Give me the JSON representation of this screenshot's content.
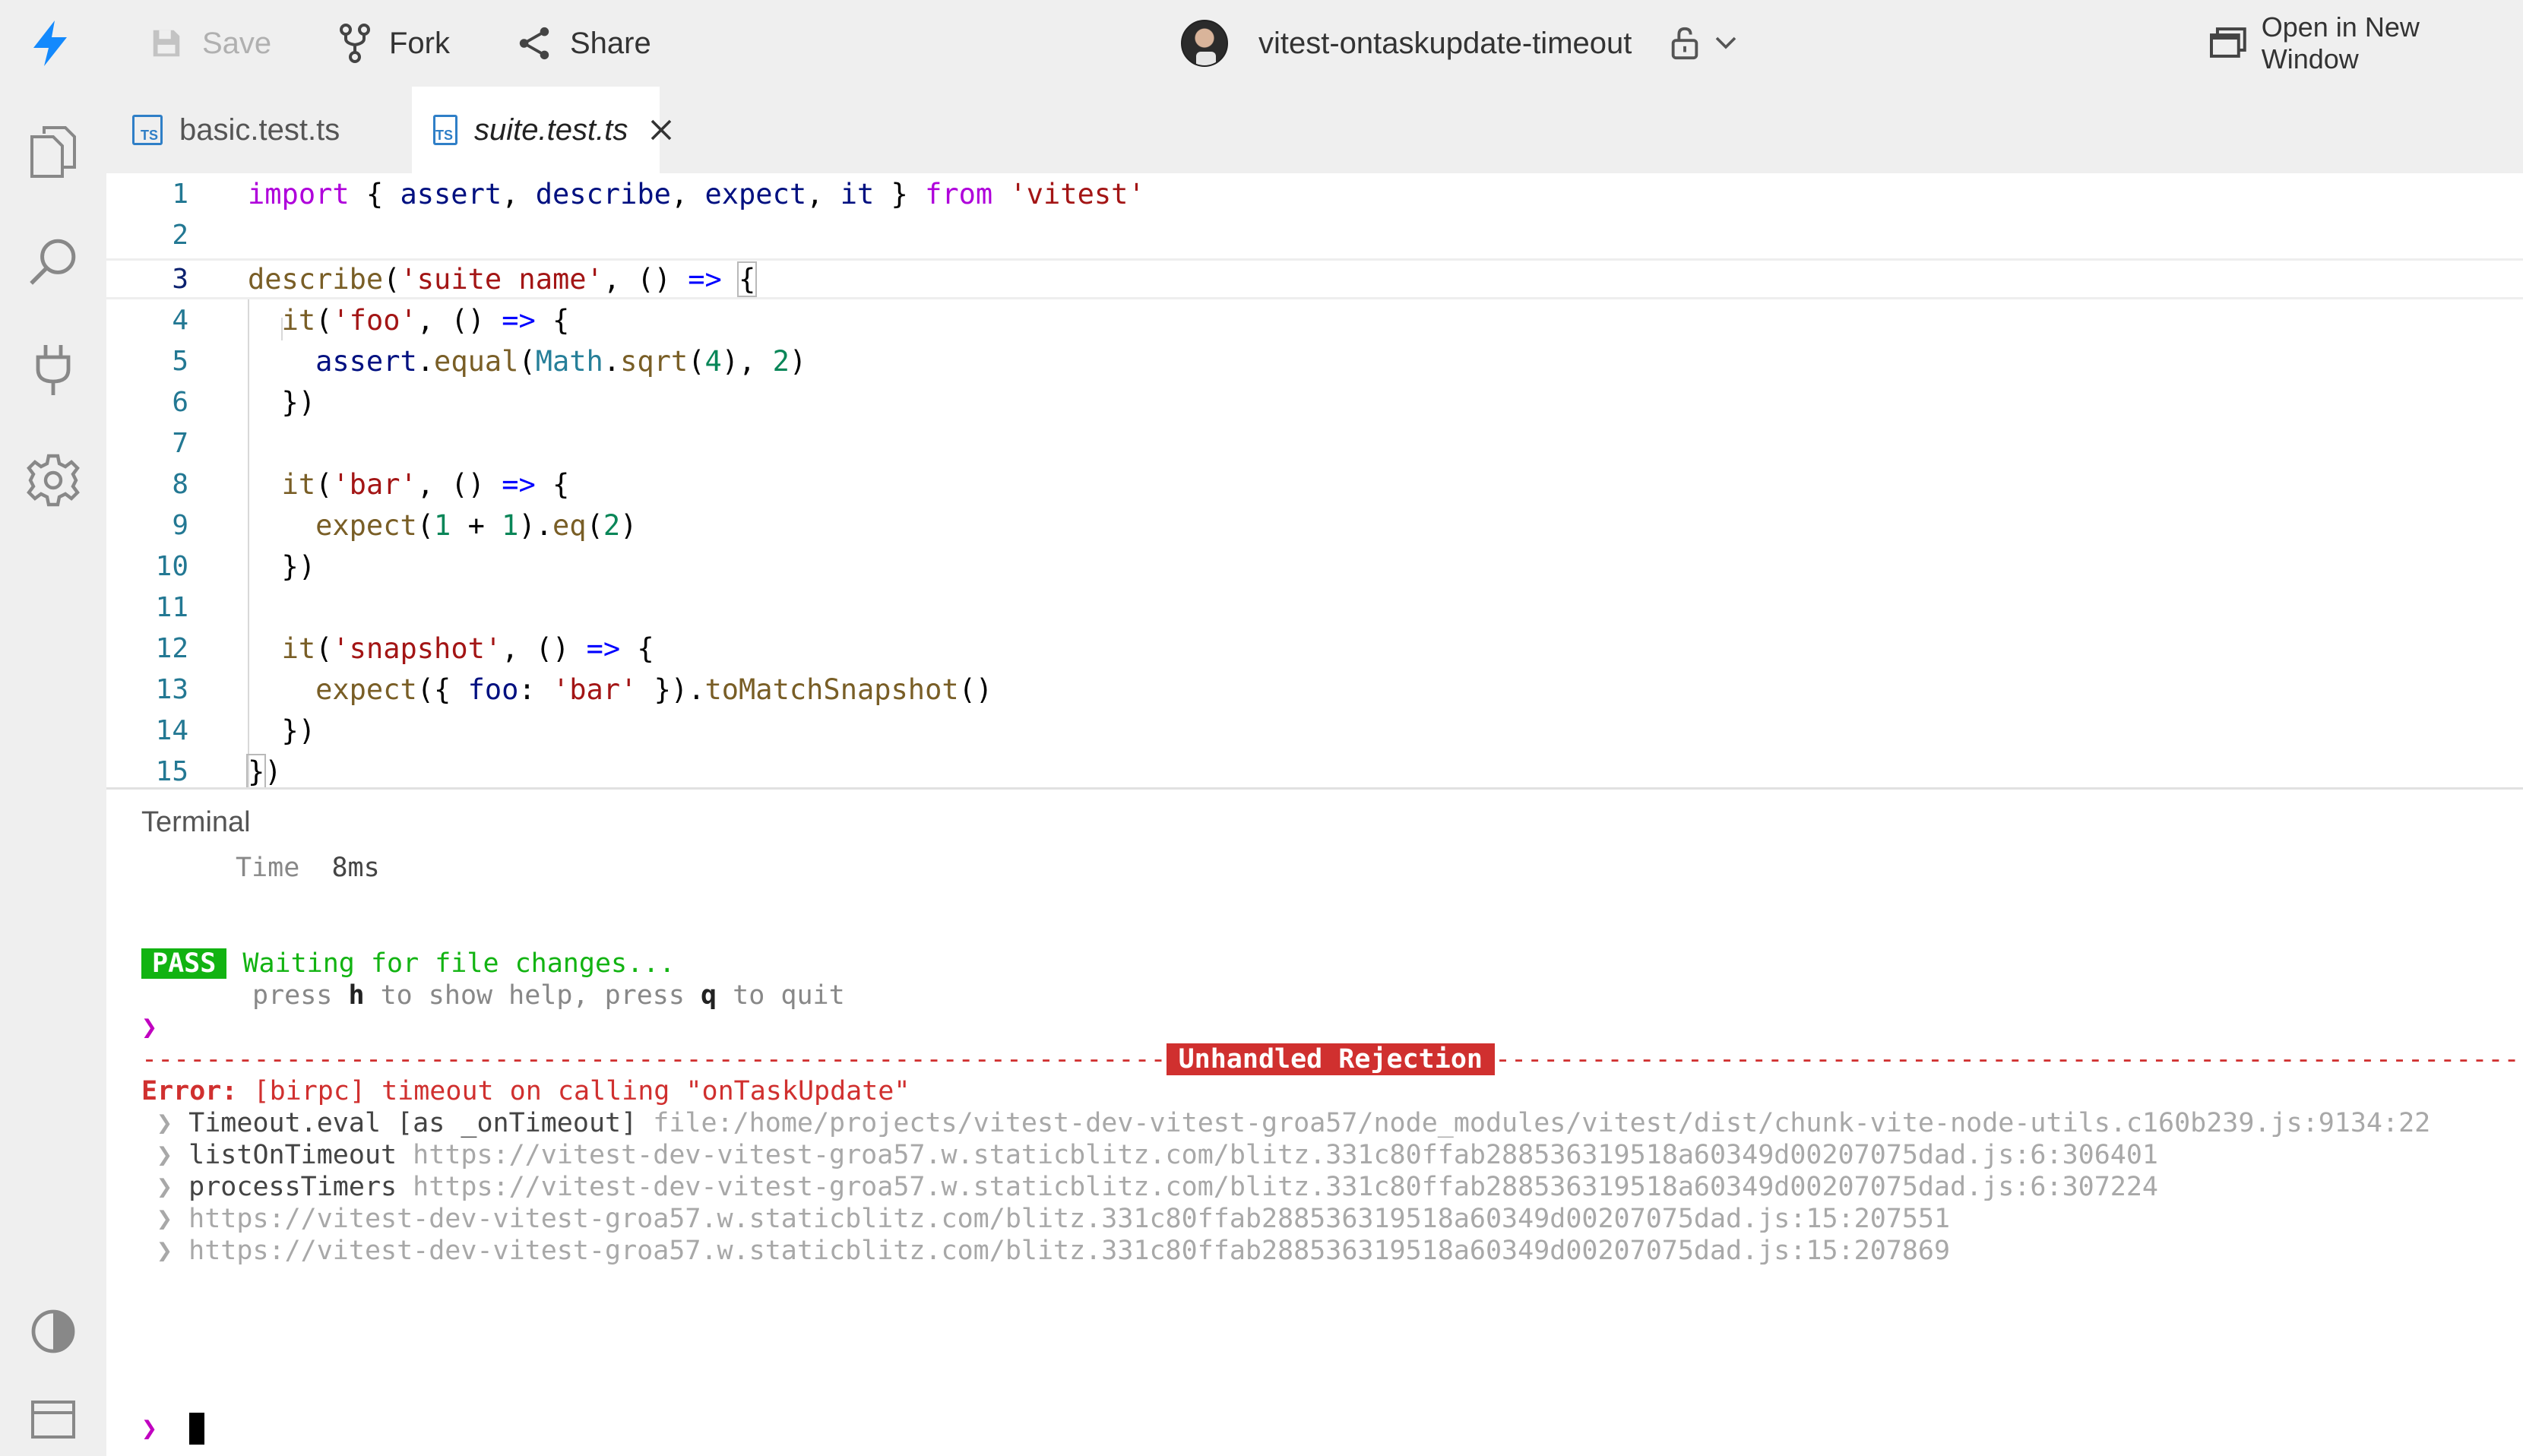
{
  "toolbar": {
    "save_label": "Save",
    "fork_label": "Fork",
    "share_label": "Share",
    "project_name": "vitest-ontaskupdate-timeout",
    "open_window_label": "Open in New Window",
    "icons": [
      "bolt-icon",
      "save-icon",
      "fork-icon",
      "share-icon",
      "lock-icon",
      "chevron-down-icon",
      "window-icon"
    ],
    "accent_color": "#1389fd"
  },
  "sidebar": {
    "icons": [
      "files-icon",
      "search-icon",
      "plug-icon",
      "gear-icon",
      "contrast-icon",
      "panel-icon"
    ]
  },
  "tabs": [
    {
      "label": "basic.test.ts",
      "badge": "TS",
      "active": false
    },
    {
      "label": "suite.test.ts",
      "badge": "TS",
      "active": true
    }
  ],
  "editor": {
    "current_line": 3,
    "lines": [
      {
        "n": "1"
      },
      {
        "n": "2"
      },
      {
        "n": "3"
      },
      {
        "n": "4"
      },
      {
        "n": "5"
      },
      {
        "n": "6"
      },
      {
        "n": "7"
      },
      {
        "n": "8"
      },
      {
        "n": "9"
      },
      {
        "n": "10"
      },
      {
        "n": "11"
      },
      {
        "n": "12"
      },
      {
        "n": "13"
      },
      {
        "n": "14"
      },
      {
        "n": "15"
      }
    ],
    "tokens": {
      "l1": [
        "import",
        " { ",
        "assert",
        ", ",
        "describe",
        ", ",
        "expect",
        ", ",
        "it",
        " } ",
        "from",
        " ",
        "'vitest'"
      ],
      "l3": [
        "describe",
        "(",
        "'suite name'",
        ", () ",
        "=>",
        " ",
        "{"
      ],
      "l4": [
        "  ",
        "it",
        "(",
        "'foo'",
        ", () ",
        "=>",
        " {"
      ],
      "l5": [
        "    ",
        "assert",
        ".",
        "equal",
        "(",
        "Math",
        ".",
        "sqrt",
        "(",
        "4",
        "), ",
        "2",
        ")"
      ],
      "l6": [
        "  })"
      ],
      "l8": [
        "  ",
        "it",
        "(",
        "'bar'",
        ", () ",
        "=>",
        " {"
      ],
      "l9": [
        "    ",
        "expect",
        "(",
        "1",
        " + ",
        "1",
        ").",
        "eq",
        "(",
        "2",
        ")"
      ],
      "l10": [
        "  })"
      ],
      "l12": [
        "  ",
        "it",
        "(",
        "'snapshot'",
        ", () ",
        "=>",
        " {"
      ],
      "l13": [
        "    ",
        "expect",
        "({ ",
        "foo",
        ": ",
        "'bar'",
        " }).",
        "toMatchSnapshot",
        "()"
      ],
      "l14": [
        "  })"
      ],
      "l15": [
        "}",
        ")"
      ]
    }
  },
  "terminal": {
    "title": "Terminal",
    "time_label": "Time",
    "time_value": "8ms",
    "pass_badge": "PASS",
    "waiting_text": "Waiting for file changes...",
    "help": [
      "press ",
      "h",
      " to show help, press ",
      "q",
      " to quit"
    ],
    "prompt": "❯",
    "rejection_dashes_left": "----------------------------------------------------------------",
    "rejection_label": "Unhandled Rejection",
    "rejection_dashes_right": "-------------------------------------------------------------------",
    "error_label": "Error:",
    "error_message": " [birpc] timeout on calling \"onTaskUpdate\"",
    "stack": [
      {
        "fn": "Timeout.eval [as _onTimeout]",
        "loc": "file:/home/projects/vitest-dev-vitest-groa57/node_modules/vitest/dist/chunk-vite-node-utils.c160b239.js:9134:22"
      },
      {
        "fn": "listOnTimeout",
        "loc": "https://vitest-dev-vitest-groa57.w.staticblitz.com/blitz.331c80ffab288536319518a60349d00207075dad.js:6:306401"
      },
      {
        "fn": "processTimers",
        "loc": "https://vitest-dev-vitest-groa57.w.staticblitz.com/blitz.331c80ffab288536319518a60349d00207075dad.js:6:307224"
      },
      {
        "fn": "",
        "loc": "https://vitest-dev-vitest-groa57.w.staticblitz.com/blitz.331c80ffab288536319518a60349d00207075dad.js:15:207551"
      },
      {
        "fn": "",
        "loc": "https://vitest-dev-vitest-groa57.w.staticblitz.com/blitz.331c80ffab288536319518a60349d00207075dad.js:15:207869"
      }
    ],
    "stack_marker": "❯"
  }
}
